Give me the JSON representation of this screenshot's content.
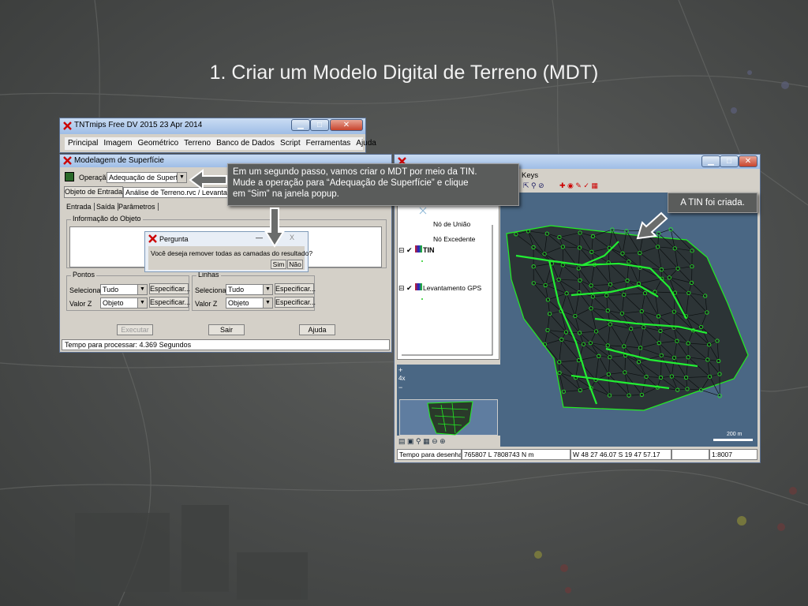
{
  "slide": {
    "title": "1. Criar um Modelo Digital de Terreno (MDT)"
  },
  "tntmips": {
    "title": "TNTmips Free DV 2015   23 Apr 2014",
    "menu": [
      "Principal",
      "Imagem",
      "Geométrico",
      "Terreno",
      "Banco de Dados",
      "Script",
      "Ferramentas",
      "Ajuda"
    ]
  },
  "modelagem": {
    "title": "Modelagem de Superfície",
    "operation_label": "Operação",
    "operation_value": "Adequação de Superfície",
    "input_button": "Objeto de Entrada...",
    "input_value": "Análise de Terreno.rvc / Levantament",
    "tabs": [
      "Entrada",
      "Saída",
      "Parâmetros"
    ],
    "object_info_label": "Informação do Objeto",
    "points_label": "Pontos",
    "lines_label": "Linhas",
    "select_label": "Selecionar",
    "valuez_label": "Valor Z",
    "points_select": "Tudo",
    "points_z": "Objeto",
    "lines_select": "Tudo",
    "lines_z": "Objeto",
    "specify_button": "Especificar...",
    "run_button": "Executar",
    "exit_button": "Sair",
    "help_button": "Ajuda",
    "status": "Tempo para processar: 4.369 Segundos"
  },
  "dialog": {
    "title": "Pergunta",
    "message": "Você deseja remover todas as camadas do resultado?",
    "yes": "Sim",
    "no": "Não",
    "close_symbol": "X",
    "min_symbol": "—"
  },
  "callout_main": {
    "line1": "Em um segundo passo, vamos criar o MDT por meio da TIN.",
    "line2": "Mude a operação para “Adequação de Superfície” e clique",
    "line3": "em “Sim” na janela popup."
  },
  "callout_tin": {
    "text": "A TIN foi criada."
  },
  "viewer": {
    "menu_partial": "Keys",
    "layers": {
      "node_union": "Nó de União",
      "node_excess": "Nó Excedente",
      "tin": "TIN",
      "gps": "Levantamento GPS"
    },
    "zoom_factor": "4x",
    "scale_bar": "200 m",
    "status": {
      "time_label": "Tempo para desenhar",
      "coords": "765807 L  7808743 N m",
      "latlon": "W 48 27 46.07  S 19 47 57.17",
      "scale": "1:8007"
    }
  },
  "colors": {
    "tin_green": "#22ee33",
    "map_blue": "#4a6784",
    "callout_gray": "#5a5c5b"
  }
}
